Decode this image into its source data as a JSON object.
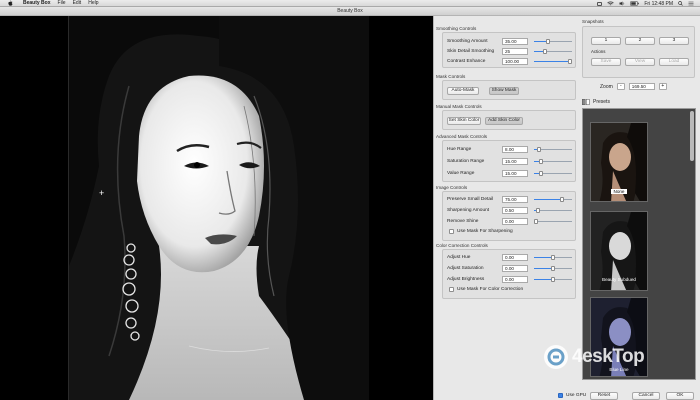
{
  "menubar": {
    "apple_icon": "apple-icon",
    "app_name": "Beauty Box",
    "menus": [
      "File",
      "Edit",
      "Help"
    ],
    "status_icons": [
      "camera-icon",
      "wifi-icon",
      "volume-icon",
      "battery-icon"
    ],
    "clock": "Fri 12:48 PM",
    "spotlight_icon": "search-icon",
    "list_icon": "list-icon"
  },
  "window": {
    "title": "Beauty Box"
  },
  "smoothing": {
    "title": "Smoothing Controls",
    "rows": [
      {
        "label": "Smoothing Amount",
        "value": "35.00",
        "fraction": 0.35
      },
      {
        "label": "Skin Detail Smoothing",
        "value": "25",
        "fraction": 0.25
      },
      {
        "label": "Contrast Enhance",
        "value": "100.00",
        "fraction": 1.0
      }
    ]
  },
  "mask": {
    "title": "Mask Controls",
    "auto_mask": "Auto-Mask",
    "show_mask": "Show Mask"
  },
  "manual_mask": {
    "title": "Manual Mask Controls",
    "set_skin": "Set Skin Color",
    "add_skin": "Add Skin Color"
  },
  "advanced_mask": {
    "title": "Advanced Mask Controls",
    "rows": [
      {
        "label": "Hue Range",
        "value": "8.00",
        "fraction": 0.1
      },
      {
        "label": "Saturation Range",
        "value": "15.00",
        "fraction": 0.15
      },
      {
        "label": "Value Range",
        "value": "15.00",
        "fraction": 0.15
      }
    ]
  },
  "image_controls": {
    "title": "Image Controls",
    "rows": [
      {
        "label": "Preserve Small Detail",
        "value": "75.00",
        "fraction": 0.75
      },
      {
        "label": "Sharpening Amount",
        "value": "0.50",
        "fraction": 0.05
      },
      {
        "label": "Remove Shine",
        "value": "0.00",
        "fraction": 0.0
      }
    ],
    "use_mask": "Use Mask For Sharpening"
  },
  "color_correction": {
    "title": "Color Correction Controls",
    "rows": [
      {
        "label": "Adjust Hue",
        "value": "0.00",
        "fraction": 0.5
      },
      {
        "label": "Adjust Saturation",
        "value": "0.00",
        "fraction": 0.5
      },
      {
        "label": "Adjust Brightness",
        "value": "0.00",
        "fraction": 0.5
      }
    ],
    "use_mask": "Use Mask For Color Correction"
  },
  "snapshots": {
    "title": "Snapshots",
    "buttons": [
      "1",
      "2",
      "3"
    ],
    "actions_label": "Actions",
    "actions": [
      "Save",
      "View",
      "Load"
    ]
  },
  "zoom": {
    "label": "Zoom",
    "minus": "-",
    "value": "169.50",
    "plus": "+"
  },
  "presets": {
    "label": "Presets",
    "items": [
      {
        "name": "None"
      },
      {
        "name": "Beauty Subdued"
      },
      {
        "name": "Blue Line"
      }
    ]
  },
  "footer": {
    "use_gpu": "Use GPU",
    "reset": "Reset",
    "cancel": "Cancel",
    "ok": "OK"
  },
  "watermark": {
    "text": "4eskTop"
  }
}
